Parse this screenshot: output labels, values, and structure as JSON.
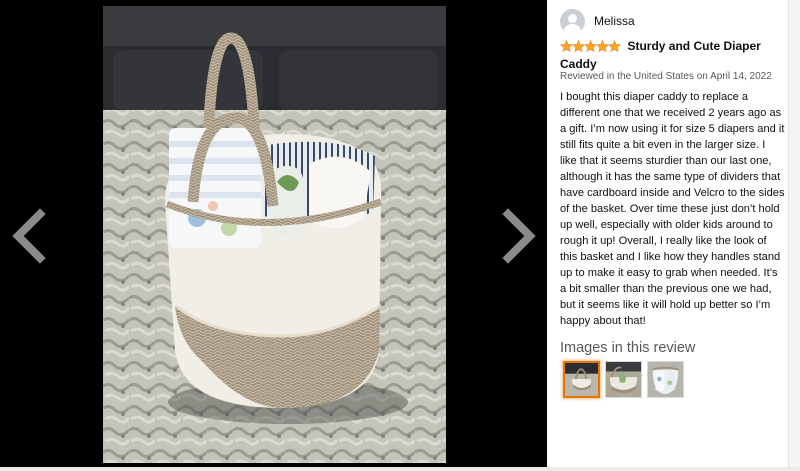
{
  "viewer": {
    "prev_icon": "chevron-left-icon",
    "next_icon": "chevron-right-icon"
  },
  "review": {
    "reviewer_name": "Melissa",
    "rating": 5,
    "rating_max": 5,
    "title": "Sturdy and Cute Diaper Caddy",
    "meta": "Reviewed in the United States on April 14, 2022",
    "body": "I bought this diaper caddy to replace a different one that we received 2 years ago as a gift. I’m now using it for size 5 diapers and it still fits quite a bit even in the larger size. I like that it seems sturdier than our last one, although it has the same type of dividers that have cardboard inside and Velcro to the sides of the basket. Over time these just don’t hold up well, especially with older kids around to rough it up! Overall, I really like the look of this basket and I like how they handles stand up to make it easy to grab when needed. It’s a bit smaller than the previous one we had, but it seems like it will hold up better so I’m happy about that!",
    "images_heading": "Images in this review",
    "thumbnail_count": 3,
    "selected_thumbnail": 1
  },
  "colors": {
    "star": "#ffa41c",
    "star_outline": "#de7921",
    "selected_border": "#e77600",
    "viewer_bg": "#000000"
  }
}
